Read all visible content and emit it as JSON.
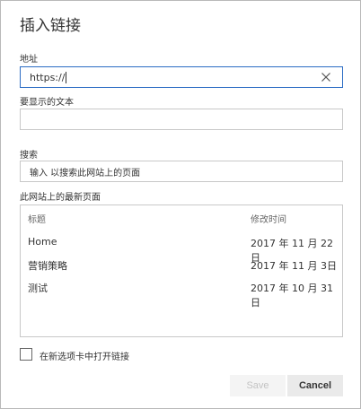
{
  "dialog": {
    "title": "插入链接"
  },
  "address": {
    "label": "地址",
    "value": "https://"
  },
  "display_text": {
    "label": "要显示的文本",
    "value": ""
  },
  "search": {
    "label": "搜索",
    "placeholder": "输入 以搜索此网站上的页面"
  },
  "recent": {
    "label": "此网站上的最新页面",
    "columns": [
      "标题",
      "修改时间"
    ],
    "rows": [
      {
        "title": "Home",
        "modified": "2017 年 11 月 22日"
      },
      {
        "title": "营销策略",
        "modified": "2017 年 11 月 3日"
      },
      {
        "title": "测试",
        "modified": "2017 年 10 月 31日"
      }
    ]
  },
  "open_new_tab": {
    "label": "在新选项卡中打开链接",
    "checked": false
  },
  "buttons": {
    "save": "Save",
    "cancel": "Cancel"
  }
}
